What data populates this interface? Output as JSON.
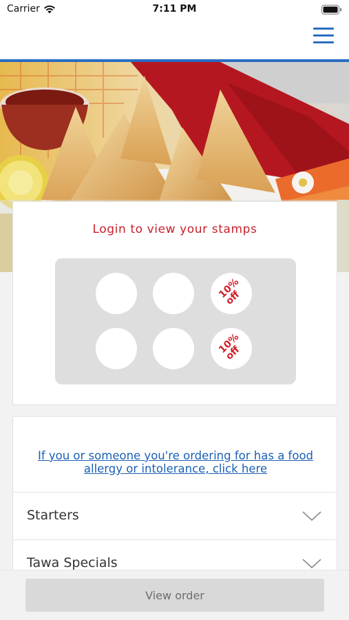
{
  "status_bar": {
    "carrier": "Carrier",
    "time": "7:11 PM",
    "wifi_icon": "wifi-icon",
    "battery_icon": "battery-icon"
  },
  "nav": {
    "menu_icon": "hamburger-menu-icon",
    "accent_color": "#2a6dc2"
  },
  "hero": {
    "image": "samosa-photo"
  },
  "stamps": {
    "title": "Login to view your stamps",
    "reward_label_line1": "10%",
    "reward_label_line2": "off",
    "reward_color": "#d11f2a"
  },
  "menu": {
    "allergy_link_line1": "If you or someone you're ordering for has a food",
    "allergy_link_line2": "allergy or intolerance, click here",
    "categories": [
      {
        "label": "Starters"
      },
      {
        "label": "Tawa Specials"
      }
    ]
  },
  "order_bar": {
    "view_order_label": "View order"
  }
}
